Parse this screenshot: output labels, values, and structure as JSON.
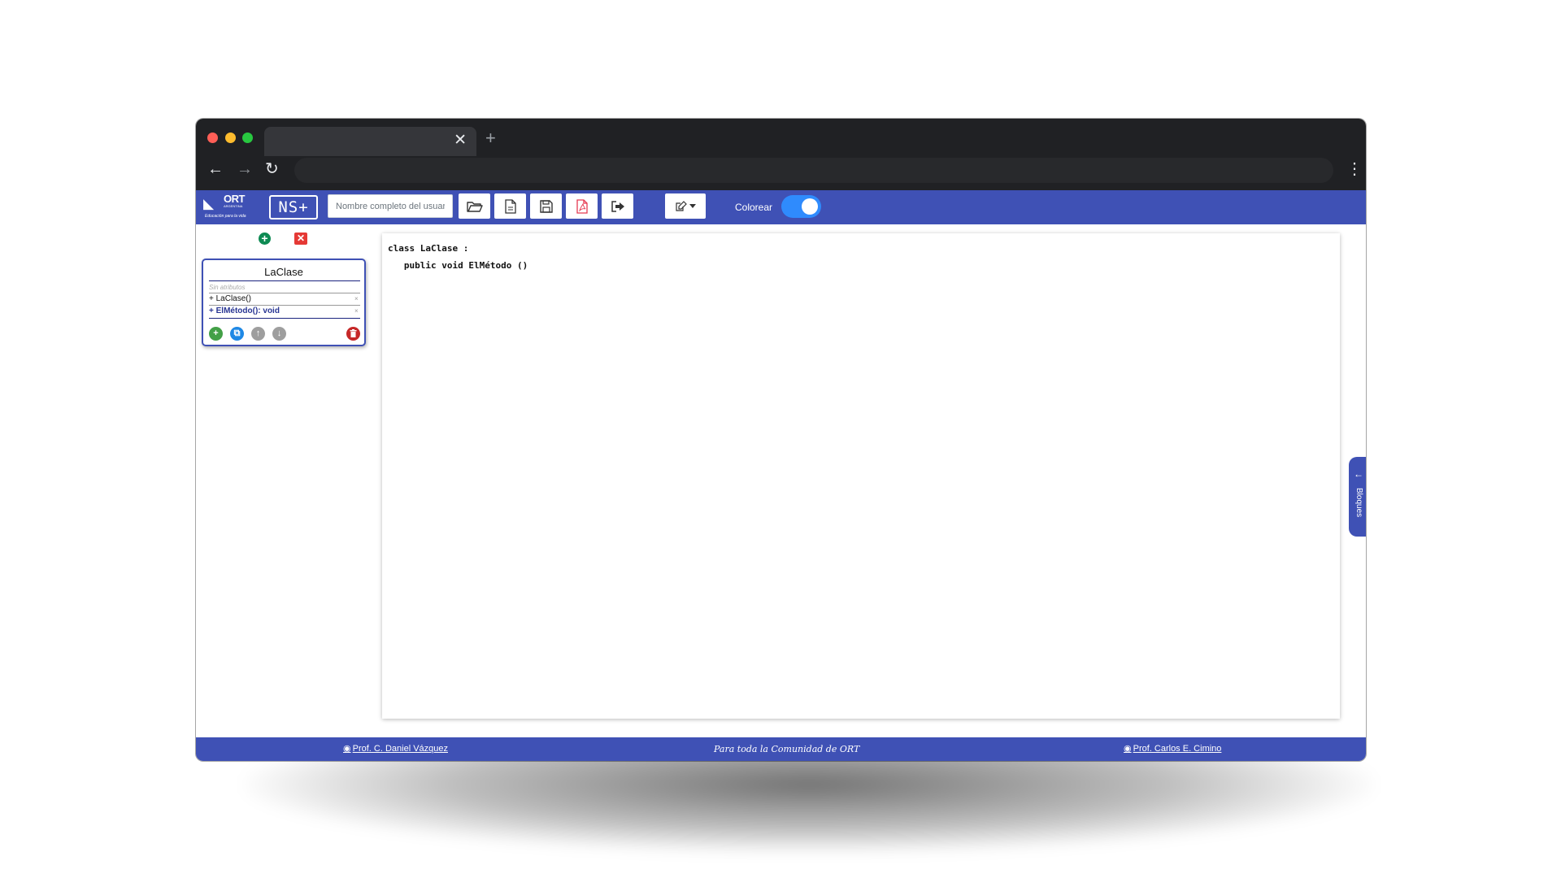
{
  "browser": {
    "tab_close": "✕",
    "new_tab": "+",
    "back": "←",
    "forward": "→",
    "reload": "↻",
    "menu": "⋮"
  },
  "toolbar": {
    "ort_logo_text": "ORT",
    "ort_logo_sub": "ARGENTINA",
    "ort_tagline": "Educación para la vida",
    "ns_logo": "NS+",
    "username_placeholder": "Nombre completo del usuario",
    "buttons": [
      "open-folder",
      "new-file",
      "save",
      "export-pdf",
      "sign-out"
    ],
    "edit_dropdown_icon": "edit-icon",
    "colorear_label": "Colorear",
    "colorear_on": true
  },
  "sidebar": {
    "add_class": "+",
    "delete_all": "✕",
    "card": {
      "class_name": "LaClase",
      "no_attributes": "Sin atributos",
      "members": [
        {
          "text": "+ LaClase()",
          "remove": "×"
        },
        {
          "text": "+ ElMétodo(): void",
          "remove": "×"
        }
      ],
      "actions": {
        "add": "+",
        "duplicate": "⧉",
        "up": "↑",
        "down": "↓",
        "delete": "🗑"
      }
    }
  },
  "editor": {
    "lines": [
      "class LaClase :",
      "   public void ElMétodo ()"
    ]
  },
  "bloques": {
    "arrow": "←",
    "label": "Bloques"
  },
  "footer": {
    "left_link": "Prof. C. Daniel Vázquez",
    "center_text": "Para toda la Comunidad de ORT",
    "right_link": "Prof. Carlos E. Cimino",
    "github_icon": "◉"
  },
  "colors": {
    "primary": "#3f51b5",
    "toggle": "#2f8bfd",
    "danger": "#e53935",
    "success": "#0d8a53"
  }
}
